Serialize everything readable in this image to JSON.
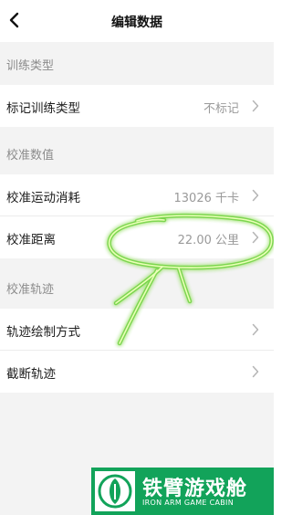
{
  "header": {
    "title": "编辑数据"
  },
  "sections": [
    {
      "title": "训练类型",
      "rows": [
        {
          "label": "标记训练类型",
          "value": "不标记"
        }
      ]
    },
    {
      "title": "校准数值",
      "rows": [
        {
          "label": "校准运动消耗",
          "value": "13026 千卡"
        },
        {
          "label": "校准距离",
          "value": "22.00 公里"
        }
      ]
    },
    {
      "title": "校准轨迹",
      "rows": [
        {
          "label": "轨迹绘制方式",
          "value": ""
        },
        {
          "label": "截断轨迹",
          "value": ""
        }
      ]
    }
  ],
  "watermark": {
    "name": "铁臂游戏舱",
    "subtitle": "IRON ARM GAME CABIN"
  },
  "colors": {
    "background": "#f3f3f3",
    "card": "#ffffff",
    "section_text": "#8c8c8c",
    "value_text": "#9a9a9a",
    "annotation_stroke": "#dfff9a",
    "annotation_glow": "#5fcf2a",
    "watermark_green": "#12a35a"
  },
  "icons": {
    "back": "chevron-left-icon",
    "row_arrow": "chevron-right-icon"
  }
}
